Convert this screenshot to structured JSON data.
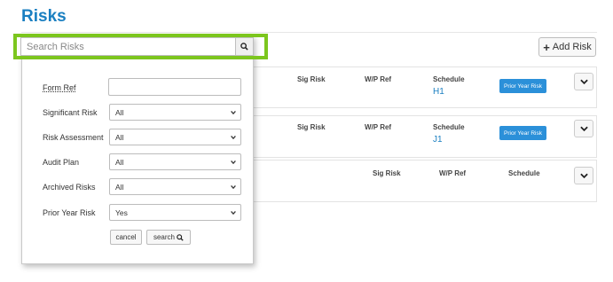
{
  "page": {
    "title": "Risks"
  },
  "toolbar": {
    "add_risk_label": "Add Risk",
    "add_risk_icon": "plus-icon"
  },
  "search": {
    "placeholder": "Search Risks",
    "value": "",
    "icon": "search-icon",
    "highlight_color": "#7cc61e"
  },
  "filters": {
    "form_ref": {
      "label": "Form Ref",
      "value": ""
    },
    "significant_risk": {
      "label": "Significant Risk",
      "value": "All"
    },
    "risk_assessment": {
      "label": "Risk Assessment",
      "value": "All"
    },
    "audit_plan": {
      "label": "Audit Plan",
      "value": "All"
    },
    "archived_risks": {
      "label": "Archived Risks",
      "value": "All"
    },
    "prior_year_risk": {
      "label": "Prior Year Risk",
      "value": "Yes"
    },
    "cancel_label": "cancel",
    "search_label": "search"
  },
  "risk_cards": [
    {
      "sig_risk_label": "Sig Risk",
      "wp_ref_label": "W/P Ref",
      "schedule_label": "Schedule",
      "schedule_value": "H1",
      "badge": "Prior Year Risk"
    },
    {
      "sig_risk_label": "Sig Risk",
      "wp_ref_label": "W/P Ref",
      "schedule_label": "Schedule",
      "schedule_value": "J1",
      "badge": "Prior Year Risk"
    },
    {
      "sig_risk_label": "Sig Risk",
      "wp_ref_label": "W/P Ref",
      "schedule_label": "Schedule",
      "schedule_value": "",
      "badge": ""
    }
  ],
  "colors": {
    "title": "#1a7fc1",
    "badge": "#2b90d9",
    "link": "#1a7fc1"
  }
}
